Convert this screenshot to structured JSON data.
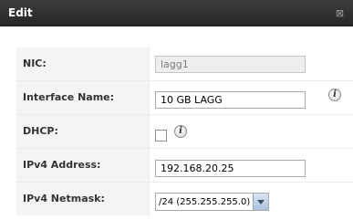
{
  "window": {
    "title": "Edit",
    "close_icon": "close-icon",
    "close_glyph": "⊠"
  },
  "form": {
    "nic": {
      "label": "NIC:",
      "value": "lagg1"
    },
    "interface_name": {
      "label": "Interface Name:",
      "value": "10 GB LAGG",
      "info_icon": "info-icon",
      "info_glyph": "i"
    },
    "dhcp": {
      "label": "DHCP:",
      "checked": false,
      "info_icon": "info-icon",
      "info_glyph": "i"
    },
    "ipv4_address": {
      "label": "IPv4 Address:",
      "value": "192.168.20.25"
    },
    "ipv4_netmask": {
      "label": "IPv4 Netmask:",
      "selected": "/24 (255.255.255.0)"
    }
  }
}
